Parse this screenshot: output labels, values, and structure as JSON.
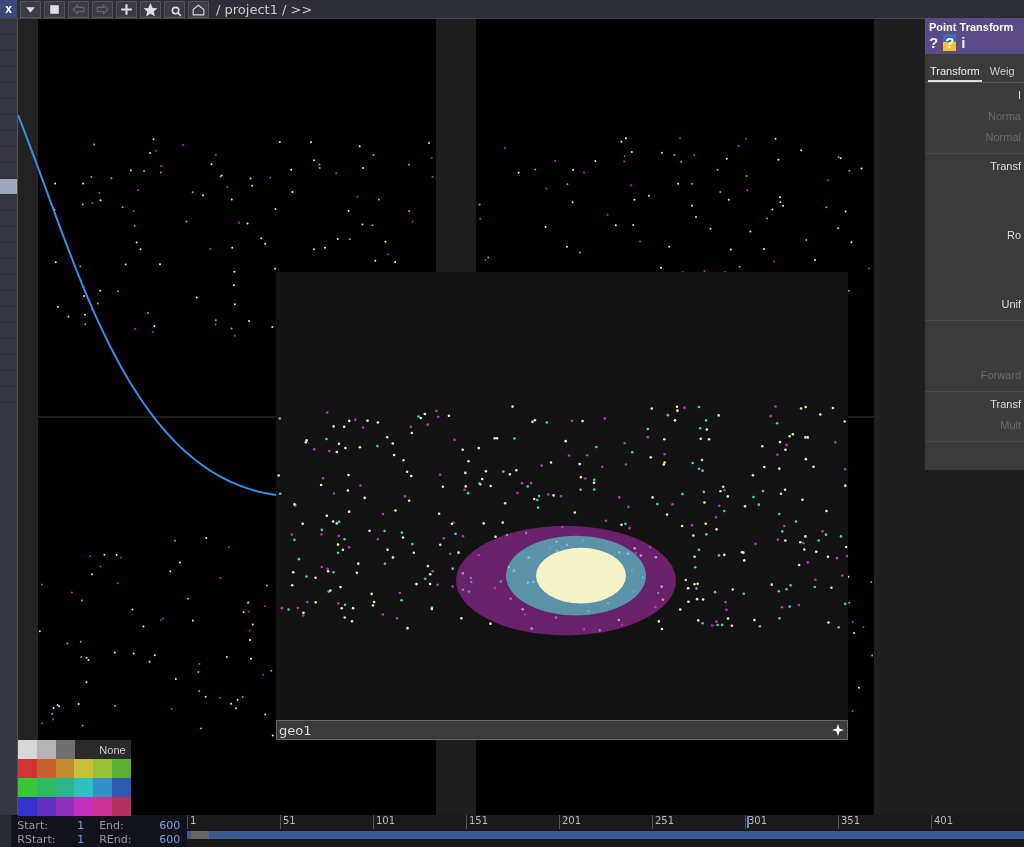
{
  "toolbar": {
    "close": "x",
    "path": "/ project1 / >>"
  },
  "viewer": {
    "label": "geo1"
  },
  "parameters": {
    "title": "Point Transform",
    "buttons": [
      {
        "label": "?",
        "kind": "help"
      },
      {
        "label": "?",
        "kind": "python"
      },
      {
        "label": "i",
        "kind": "info"
      }
    ],
    "tabs": [
      {
        "label": "Transform",
        "selected": true
      },
      {
        "label": "Weig",
        "selected": false
      }
    ],
    "groups": [
      [
        {
          "label": "I",
          "disabled": false
        },
        {
          "label": "Norma",
          "disabled": true
        },
        {
          "label": "Normal",
          "disabled": true
        }
      ],
      [
        {
          "label": "Transf",
          "disabled": false
        },
        {
          "label": "Ro",
          "disabled": false
        },
        {
          "label": "Unif",
          "disabled": false
        }
      ],
      [
        {
          "label": "Forward",
          "disabled": true
        }
      ],
      [
        {
          "label": "Transf",
          "disabled": false
        },
        {
          "label": "Mult",
          "disabled": true
        }
      ]
    ]
  },
  "palette": {
    "none_label": "None",
    "swatches": [
      {
        "color": "#d8d8d8"
      },
      {
        "color": "#b4b4b4"
      },
      {
        "color": "#707070"
      },
      {
        "color": "#2a2a2a"
      },
      {
        "color": "#d03434"
      },
      {
        "color": "#c86030"
      },
      {
        "color": "#c08c2c"
      },
      {
        "color": "#c8c038"
      },
      {
        "color": "#98c038"
      },
      {
        "color": "#5cb034"
      },
      {
        "color": "#34c834"
      },
      {
        "color": "#2cbc60"
      },
      {
        "color": "#2cb48c"
      },
      {
        "color": "#30c0c0"
      },
      {
        "color": "#3490c8"
      },
      {
        "color": "#3058b0"
      },
      {
        "color": "#3034c8"
      },
      {
        "color": "#6430c0"
      },
      {
        "color": "#9030bc"
      },
      {
        "color": "#c030c0"
      },
      {
        "color": "#c83490"
      },
      {
        "color": "#b03060"
      }
    ]
  },
  "time_range": [
    {
      "label": "Start:",
      "value": "1"
    },
    {
      "label": "End:",
      "value": "600"
    },
    {
      "label": "RStart:",
      "value": "1"
    },
    {
      "label": "REnd:",
      "value": "600"
    }
  ],
  "timeline": {
    "ticks": [
      "1",
      "51",
      "101",
      "151",
      "201",
      "251",
      "301",
      "351",
      "401"
    ]
  }
}
